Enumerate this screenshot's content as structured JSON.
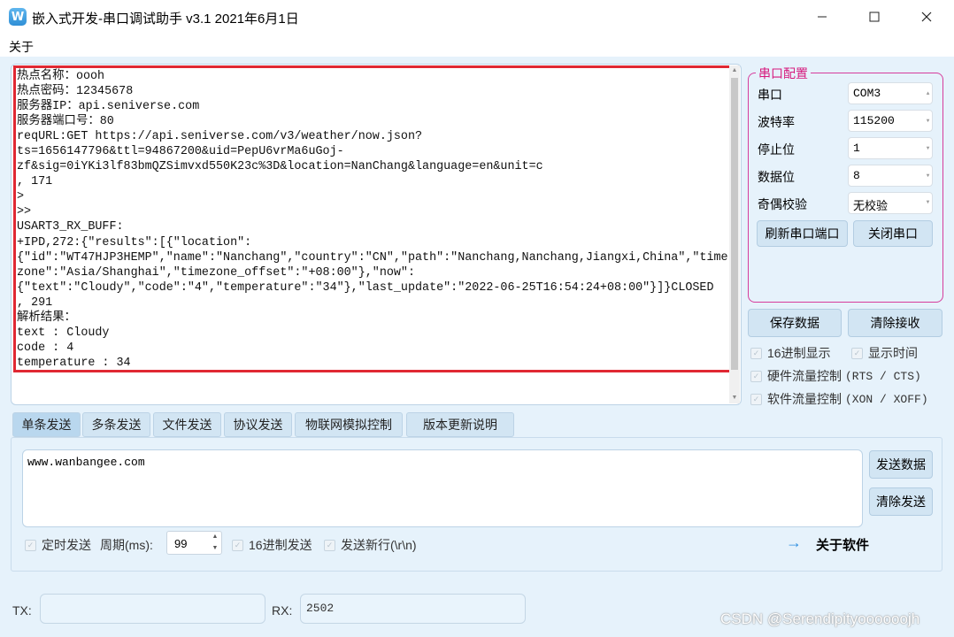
{
  "app": {
    "icon_letter": "W",
    "title": "嵌入式开发-串口调试助手 v3.1 2021年6月1日"
  },
  "window_controls": {
    "minimize": "—",
    "maximize": "☐",
    "close": "✕"
  },
  "menu": {
    "about": "关于"
  },
  "receive": {
    "lines": "热点名称：oooh\n热点密码：12345678\n服务器IP：api.seniverse.com\n服务器端口号：80\nreqURL:GET https://api.seniverse.com/v3/weather/now.json?\nts=1656147796&ttl=94867200&uid=PepU6vrMa6uGoj-\nzf&sig=0iYKi3lf83bmQZSimvxd550K23c%3D&location=NanChang&language=en&unit=c\n, 171\n>\n>>\nUSART3_RX_BUFF:\n+IPD,272:{\"results\":[{\"location\":\n{\"id\":\"WT47HJP3HEMP\",\"name\":\"Nanchang\",\"country\":\"CN\",\"path\":\"Nanchang,Nanchang,Jiangxi,China\",\"time\nzone\":\"Asia/Shanghai\",\"timezone_offset\":\"+08:00\"},\"now\":\n{\"text\":\"Cloudy\",\"code\":\"4\",\"temperature\":\"34\"},\"last_update\":\"2022-06-25T16:54:24+08:00\"}]}CLOSED\n, 291\n解析结果：\ntext : Cloudy\ncode : 4\ntemperature : 34"
  },
  "serial_config": {
    "title": "串口配置",
    "rows": [
      {
        "label": "串口",
        "value": "COM3"
      },
      {
        "label": "波特率",
        "value": "115200"
      },
      {
        "label": "停止位",
        "value": "1"
      },
      {
        "label": "数据位",
        "value": "8"
      },
      {
        "label": "奇偶校验",
        "value": "无校验"
      }
    ],
    "refresh_button": "刷新串口端口",
    "close_button": "关闭串口"
  },
  "receive_actions": {
    "save_button": "保存数据",
    "clear_button": "清除接收",
    "hex_display": "16进制显示",
    "show_time": "显示时间",
    "hw_flow": "硬件流量控制",
    "hw_flow_detail": "(RTS / CTS)",
    "sw_flow": "软件流量控制",
    "sw_flow_detail": "(XON / XOFF)"
  },
  "tabs": [
    "单条发送",
    "多条发送",
    "文件发送",
    "协议发送",
    "物联网模拟控制",
    "版本更新说明"
  ],
  "send": {
    "text": "www.wanbangee.com",
    "send_button": "发送数据",
    "clear_button": "清除发送",
    "timed_send": "定时发送",
    "period_label": "周期(ms):",
    "period_value": "99",
    "hex_send": "16进制发送",
    "send_newline": "发送新行(\\r\\n)",
    "arrow": "→",
    "about_software": "关于软件"
  },
  "status": {
    "tx_label": "TX:",
    "tx_value": "",
    "rx_label": "RX:",
    "rx_value": "2502"
  },
  "watermark": "CSDN @Serendipityoooooojh"
}
